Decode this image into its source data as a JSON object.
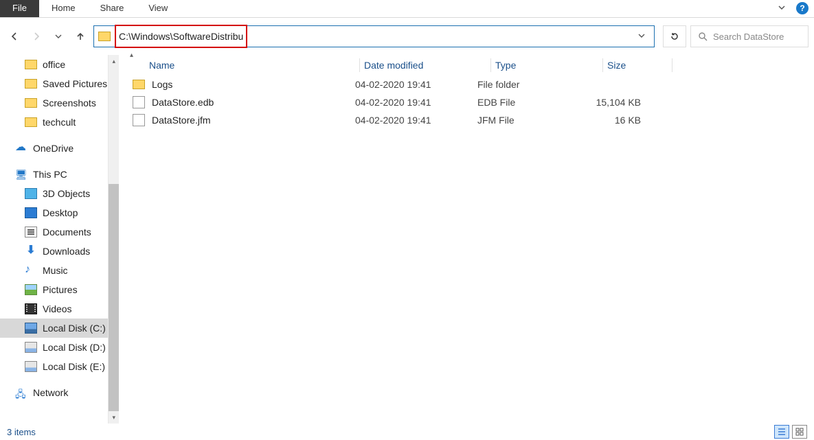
{
  "ribbon": {
    "file": "File",
    "home": "Home",
    "share": "Share",
    "view": "View"
  },
  "address": {
    "path": "C:\\Windows\\SoftwareDistribution\\DataStore"
  },
  "search": {
    "placeholder": "Search DataStore"
  },
  "sidebar": {
    "quick": [
      {
        "label": "office",
        "icon": "folder"
      },
      {
        "label": "Saved Pictures",
        "icon": "folder"
      },
      {
        "label": "Screenshots",
        "icon": "folder"
      },
      {
        "label": "techcult",
        "icon": "folder"
      }
    ],
    "onedrive": "OneDrive",
    "thispc": "This PC",
    "pc_items": [
      {
        "label": "3D Objects",
        "icon": "3d"
      },
      {
        "label": "Desktop",
        "icon": "desktop"
      },
      {
        "label": "Documents",
        "icon": "doc"
      },
      {
        "label": "Downloads",
        "icon": "dl"
      },
      {
        "label": "Music",
        "icon": "music"
      },
      {
        "label": "Pictures",
        "icon": "pic"
      },
      {
        "label": "Videos",
        "icon": "vid"
      },
      {
        "label": "Local Disk (C:)",
        "icon": "diskc",
        "selected": true
      },
      {
        "label": "Local Disk (D:)",
        "icon": "disk"
      },
      {
        "label": "Local Disk (E:)",
        "icon": "disk"
      }
    ],
    "network": "Network"
  },
  "columns": {
    "name": "Name",
    "date": "Date modified",
    "type": "Type",
    "size": "Size"
  },
  "rows": [
    {
      "icon": "folder",
      "name": "Logs",
      "date": "04-02-2020 19:41",
      "type": "File folder",
      "size": ""
    },
    {
      "icon": "file",
      "name": "DataStore.edb",
      "date": "04-02-2020 19:41",
      "type": "EDB File",
      "size": "15,104 KB"
    },
    {
      "icon": "file",
      "name": "DataStore.jfm",
      "date": "04-02-2020 19:41",
      "type": "JFM File",
      "size": "16 KB"
    }
  ],
  "status": {
    "count": "3 items"
  }
}
